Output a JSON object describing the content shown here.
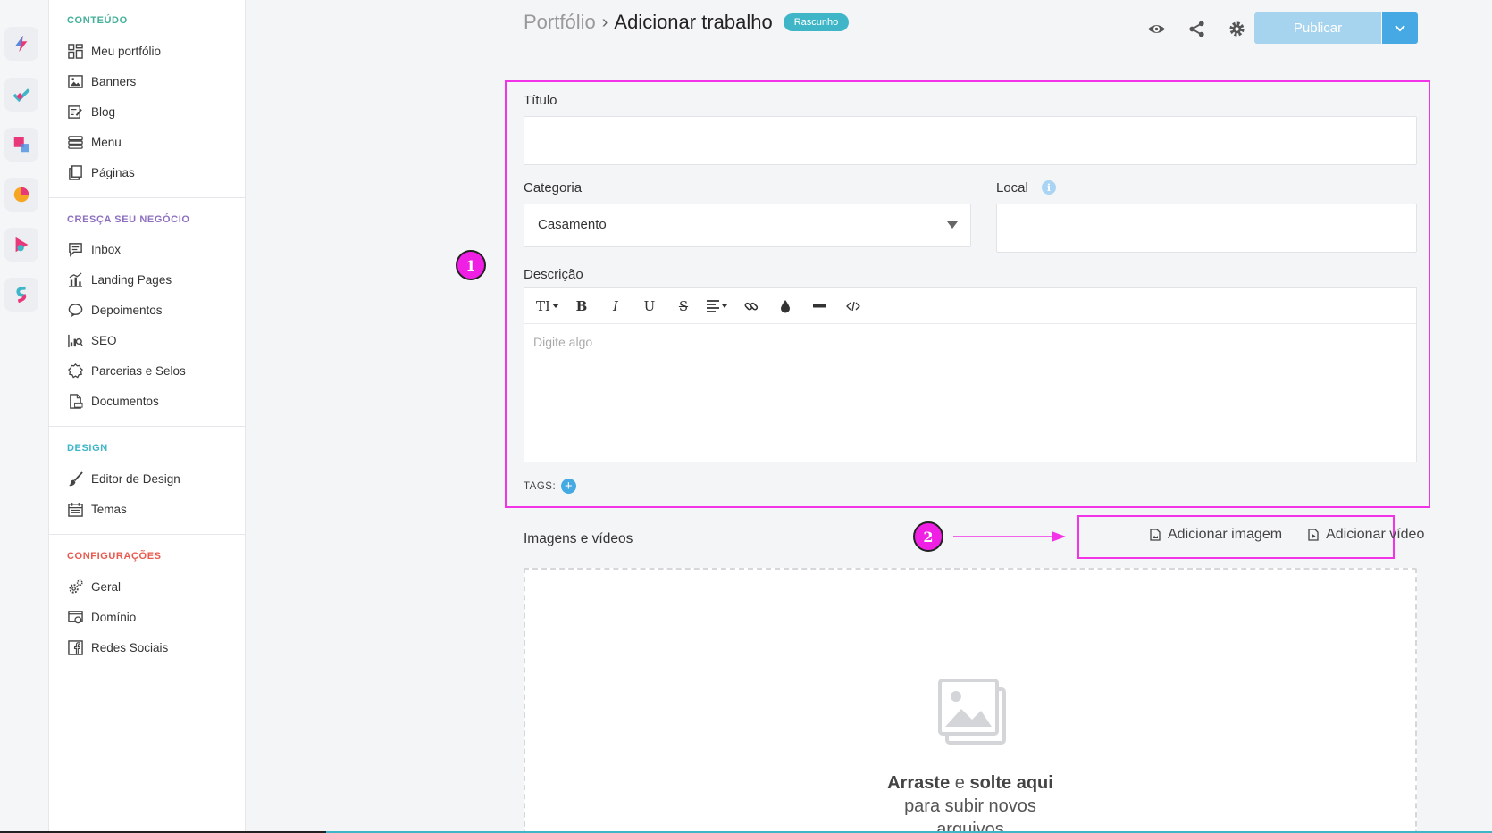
{
  "rail": [
    {
      "name": "app-bolt",
      "color": "#e8387a",
      "accent": "#4a90e2"
    },
    {
      "name": "app-check",
      "color": "#3fb6c8",
      "accent": "#e8387a"
    },
    {
      "name": "app-square",
      "color": "#e8387a",
      "accent": "#4a90e2"
    },
    {
      "name": "app-pie",
      "color": "#f5a623",
      "accent": "#e8387a"
    },
    {
      "name": "app-play",
      "color": "#e8387a",
      "accent": "#3fb6c8"
    },
    {
      "name": "app-s",
      "color": "#e8387a",
      "accent": "#3fb6c8"
    }
  ],
  "sidebar": {
    "sections": [
      {
        "title": "CONTEÚDO",
        "color": "#43b09a",
        "items": [
          {
            "label": "Meu portfólio",
            "icon": "grid-icon"
          },
          {
            "label": "Banners",
            "icon": "image-icon"
          },
          {
            "label": "Blog",
            "icon": "edit-icon"
          },
          {
            "label": "Menu",
            "icon": "list-icon"
          },
          {
            "label": "Páginas",
            "icon": "pages-icon"
          }
        ]
      },
      {
        "title": "CRESÇA SEU NEGÓCIO",
        "color": "#8e6fbf",
        "items": [
          {
            "label": "Inbox",
            "icon": "chat-icon"
          },
          {
            "label": "Landing Pages",
            "icon": "chart-icon"
          },
          {
            "label": "Depoimentos",
            "icon": "comment-icon"
          },
          {
            "label": "SEO",
            "icon": "seo-icon"
          },
          {
            "label": "Parcerias e Selos",
            "icon": "badge-icon"
          },
          {
            "label": "Documentos",
            "icon": "pdf-icon"
          }
        ]
      },
      {
        "title": "DESIGN",
        "color": "#3fb6c8",
        "items": [
          {
            "label": "Editor de Design",
            "icon": "brush-icon"
          },
          {
            "label": "Temas",
            "icon": "calendar-icon"
          }
        ]
      },
      {
        "title": "CONFIGURAÇÕES",
        "color": "#e85a4f",
        "items": [
          {
            "label": "Geral",
            "icon": "gears-icon"
          },
          {
            "label": "Domínio",
            "icon": "domain-icon"
          },
          {
            "label": "Redes Sociais",
            "icon": "facebook-icon"
          }
        ]
      }
    ]
  },
  "header": {
    "breadcrumb_root": "Portfólio",
    "breadcrumb_sep": "›",
    "breadcrumb_current": "Adicionar trabalho",
    "status_badge": "Rascunho",
    "publish_label": "Publicar"
  },
  "form": {
    "title_label": "Título",
    "title_value": "",
    "category_label": "Categoria",
    "category_value": "Casamento",
    "local_label": "Local",
    "local_value": "",
    "description_label": "Descrição",
    "description_placeholder": "Digite algo",
    "tags_label": "TAGS:"
  },
  "editor_toolbar": [
    "TI",
    "B",
    "I",
    "U",
    "S",
    "align",
    "link",
    "color",
    "hr",
    "code"
  ],
  "media": {
    "section_label": "Imagens e vídeos",
    "add_image": "Adicionar imagem",
    "add_video": "Adicionar vídeo",
    "drop_strong1": "Arraste",
    "drop_mid": "e",
    "drop_strong2": "solte aqui",
    "drop_line2": "para subir novos",
    "drop_line3": "arquivos"
  },
  "annotations": {
    "one": "1",
    "two": "2",
    "color": "#f233e7"
  }
}
